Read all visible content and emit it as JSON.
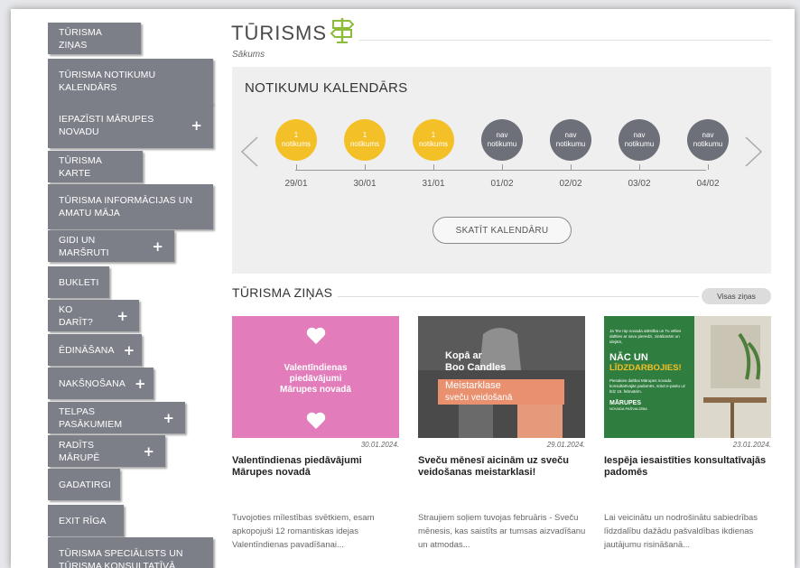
{
  "header": {
    "title": "TŪRISMS",
    "breadcrumb": "Sākums"
  },
  "sidebar": {
    "items": [
      {
        "label": "TŪRISMA ZIŅAS",
        "has_plus": false
      },
      {
        "label": "TŪRISMA NOTIKUMU KALENDĀRS",
        "has_plus": false
      },
      {
        "label": "IEPAZĪSTI MĀRUPES NOVADU",
        "has_plus": true
      },
      {
        "label": "TŪRISMA KARTE",
        "has_plus": false
      },
      {
        "label": "TŪRISMA INFORMĀCIJAS UN AMATU MĀJA",
        "has_plus": false
      },
      {
        "label": "GIDI UN MARŠRUTI",
        "has_plus": true
      },
      {
        "label": "BUKLETI",
        "has_plus": false
      },
      {
        "label": "KO DARĪT?",
        "has_plus": true
      },
      {
        "label": "ĒDINĀŠANA",
        "has_plus": true
      },
      {
        "label": "NAKŠŅOŠANA",
        "has_plus": true
      },
      {
        "label": "TELPAS PASĀKUMIEM",
        "has_plus": true
      },
      {
        "label": "RADĪTS MĀRUPĒ",
        "has_plus": true
      },
      {
        "label": "GADATIRGI",
        "has_plus": false
      },
      {
        "label": "EXIT RĪGA",
        "has_plus": false
      },
      {
        "label": "TŪRISMA SPECIĀLISTS UN TŪRISMA KONSULTATĪVĀ",
        "has_plus": false
      }
    ],
    "plus_symbol": "+"
  },
  "calendar": {
    "title": "NOTIKUMU KALENDĀRS",
    "button": "SKATĪT KALENDĀRU",
    "days": [
      {
        "count": "1",
        "word": "notikums",
        "date": "29/01",
        "active": true
      },
      {
        "count": "1",
        "word": "notikums",
        "date": "30/01",
        "active": true
      },
      {
        "count": "1",
        "word": "notikums",
        "date": "31/01",
        "active": true
      },
      {
        "count": "nav",
        "word": "notikumu",
        "date": "01/02",
        "active": false
      },
      {
        "count": "nav",
        "word": "notikumu",
        "date": "02/02",
        "active": false
      },
      {
        "count": "nav",
        "word": "notikumu",
        "date": "03/02",
        "active": false
      },
      {
        "count": "nav",
        "word": "notikumu",
        "date": "04/02",
        "active": false
      }
    ],
    "colors": {
      "active": "#f4c027",
      "inactive": "#6e7079",
      "panel": "#efefef"
    }
  },
  "news": {
    "title": "TŪRISMA ZIŅAS",
    "all_link": "Visas ziņas",
    "cards": [
      {
        "date": "30.01.2024.",
        "heading": "Valentīndienas piedāvājumi Mārupes novadā",
        "excerpt": "Tuvojoties mīlestības svētkiem, esam apkopojuši 12 romantiskas idejas Valentīndienas pavadīšanai...",
        "image_text": [
          "Valentīndienas",
          "piedāvājumi",
          "Mārupes novadā"
        ]
      },
      {
        "date": "29.01.2024.",
        "heading": "Sveču mēnesī aicinām uz sveču veidošanas meistarklasi!",
        "excerpt": "Straujiem soļiem tuvojas februāris - Sveču mēnesis, kas saistīts ar tumsas aizvadīšanu un atmodas...",
        "image_text": [
          "Kopā ar",
          "Boo Candles",
          "Meistarklase",
          "sveču veidošanā"
        ]
      },
      {
        "date": "23.01.2024.",
        "heading": "Iespēja iesaistīties konsultatīvajās padomēs",
        "excerpt": "Lai veicinātu un nodrošinātu sabiedrības līdzdalību dažādu pašvaldības ikdienas jautājumu risināšanā...",
        "image_text": [
          "Ja Tev rūp novada attīstība un Tu vēlies dalīties ar savu pieredzi, zināšanām un idejām,",
          "NĀC UN",
          "LĪDZDARBOJIES!",
          "Piesakies dalībai Mārupes novada konsultatīvajās padomēs, sūtot e-pastu uz",
          "līdz 15. februārim.",
          "MĀRUPES",
          "NOVADA PAŠVALDĪBA"
        ]
      }
    ]
  },
  "icons": {
    "title_icon": "signpost-icon",
    "prev": "chevron-left-icon",
    "next": "chevron-right-icon",
    "heart": "heart-icon"
  },
  "colors": {
    "sidebar": "#7c7f88",
    "accent_green": "#8dbb3a",
    "pink": "#e37cbb",
    "green_card": "#2f7d3f"
  }
}
